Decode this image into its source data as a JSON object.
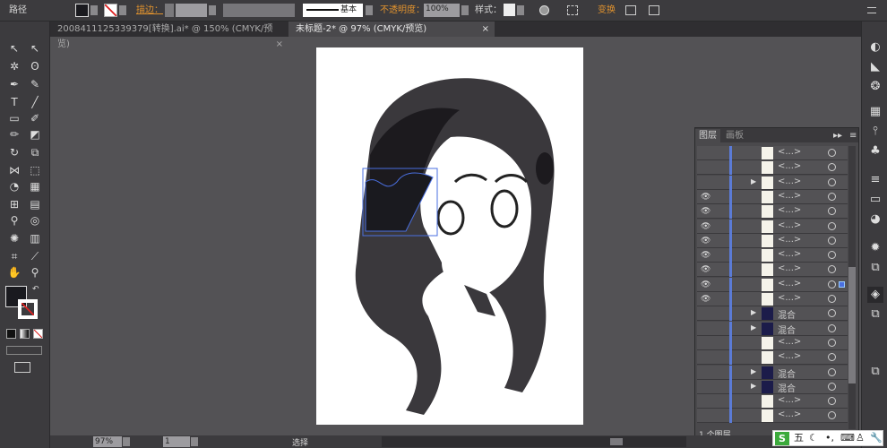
{
  "control_bar": {
    "object_type": "路径",
    "stroke_label": "描边：",
    "stroke_profile": "基本",
    "opacity_label": "不透明度：",
    "opacity_value": "100%",
    "style_label": "样式：",
    "transform_label": "变换",
    "colors": {
      "fill": "#1a1a1f",
      "accent_label": "#e0922e"
    }
  },
  "tabs": [
    {
      "label": "20084111253393​79[转换].ai* @ 150% (CMYK/预览)",
      "close": "×"
    },
    {
      "label": "未标题-2* @ 97% (CMYK/预览)",
      "close": "×",
      "active": true
    }
  ],
  "layers_panel": {
    "tabs": [
      "图层",
      "画板"
    ],
    "footer": "1 个图层",
    "rows": [
      {
        "eye": false,
        "expand": false,
        "label": "<...>"
      },
      {
        "eye": false,
        "expand": false,
        "label": "<...>"
      },
      {
        "eye": false,
        "expand": true,
        "label": "<...>"
      },
      {
        "eye": true,
        "expand": false,
        "label": "<...>"
      },
      {
        "eye": true,
        "expand": false,
        "label": "<...>"
      },
      {
        "eye": true,
        "expand": false,
        "label": "<...>"
      },
      {
        "eye": true,
        "expand": false,
        "label": "<...>"
      },
      {
        "eye": true,
        "expand": false,
        "label": "<...>"
      },
      {
        "eye": true,
        "expand": false,
        "label": "<...>"
      },
      {
        "eye": true,
        "expand": false,
        "label": "<...>",
        "selected": true
      },
      {
        "eye": true,
        "expand": false,
        "label": "<...>"
      },
      {
        "eye": false,
        "expand": true,
        "label": "混合"
      },
      {
        "eye": false,
        "expand": true,
        "label": "混合"
      },
      {
        "eye": false,
        "expand": false,
        "label": "<...>"
      },
      {
        "eye": false,
        "expand": false,
        "label": "<...>"
      },
      {
        "eye": false,
        "expand": true,
        "label": "混合"
      },
      {
        "eye": false,
        "expand": true,
        "label": "混合"
      },
      {
        "eye": false,
        "expand": false,
        "label": "<...>"
      },
      {
        "eye": false,
        "expand": false,
        "label": "<...>"
      }
    ]
  },
  "status_bar": {
    "zoom": "97%",
    "page": "1",
    "tool": "选择"
  },
  "ime_bar": {
    "logo": "S",
    "mode": "五"
  }
}
